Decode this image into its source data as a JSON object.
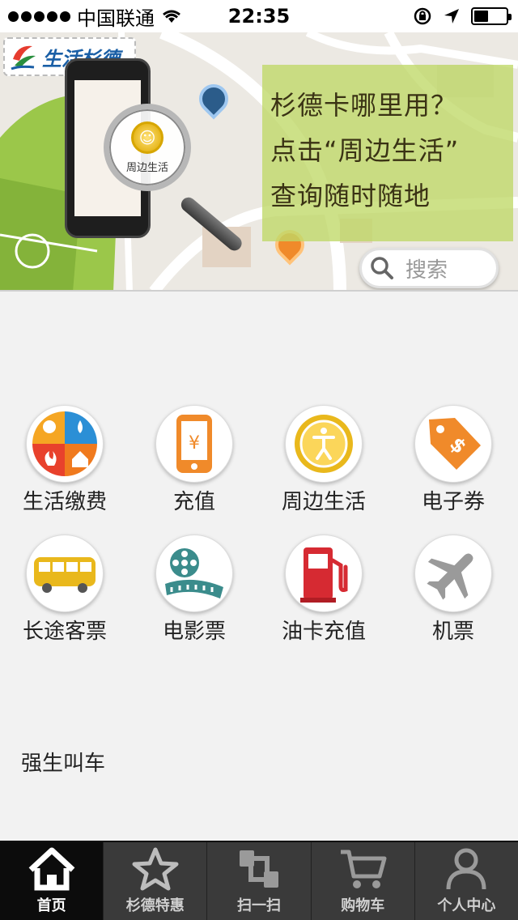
{
  "status_bar": {
    "carrier": "中国联通",
    "time": "22:35",
    "battery_level": 0.45
  },
  "banner": {
    "logo_text": "生活杉德",
    "magnifier_label": "周边生活",
    "promo_lines": [
      "杉德卡哪里用？",
      "点击“周边生活”",
      "查询随时随地"
    ],
    "search_placeholder": "搜索"
  },
  "services": [
    {
      "label": "生活缴费",
      "icon": "utilities-icon"
    },
    {
      "label": "充值",
      "icon": "phone-recharge-icon"
    },
    {
      "label": "周边生活",
      "icon": "nearby-life-icon"
    },
    {
      "label": "电子券",
      "icon": "coupon-tag-icon"
    },
    {
      "label": "长途客票",
      "icon": "bus-icon"
    },
    {
      "label": "电影票",
      "icon": "film-reel-icon"
    },
    {
      "label": "油卡充值",
      "icon": "fuel-pump-icon"
    },
    {
      "label": "机票",
      "icon": "airplane-icon"
    }
  ],
  "extra_service": "强生叫车",
  "tabbar": {
    "items": [
      {
        "label": "首页",
        "icon": "home-icon",
        "active": true
      },
      {
        "label": "杉德特惠",
        "icon": "star-icon",
        "active": false
      },
      {
        "label": "扫一扫",
        "icon": "scan-icon",
        "active": false
      },
      {
        "label": "购物车",
        "icon": "cart-icon",
        "active": false
      },
      {
        "label": "个人中心",
        "icon": "person-icon",
        "active": false
      }
    ]
  },
  "colors": {
    "promo_overlay": "#bfd866",
    "tab_active_bg": "#0c0c0c",
    "tab_bg": "#3a3a3a",
    "accent_orange": "#f08a2a",
    "accent_yellow": "#e7b820"
  }
}
